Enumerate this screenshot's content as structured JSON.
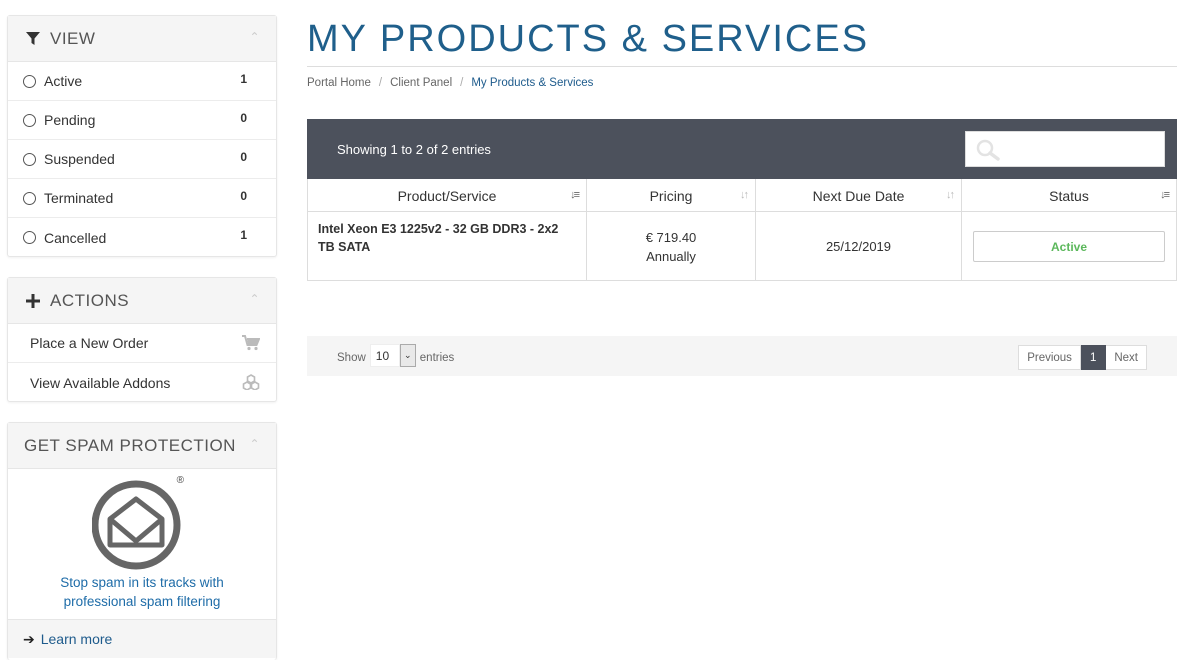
{
  "sidebar": {
    "view": {
      "title": "VIEW",
      "items": [
        {
          "label": "Active",
          "count": "1"
        },
        {
          "label": "Pending",
          "count": "0"
        },
        {
          "label": "Suspended",
          "count": "0"
        },
        {
          "label": "Terminated",
          "count": "0"
        },
        {
          "label": "Cancelled",
          "count": "1"
        }
      ]
    },
    "actions": {
      "title": "ACTIONS",
      "items": [
        {
          "label": "Place a New Order",
          "icon": "cart-icon"
        },
        {
          "label": "View Available Addons",
          "icon": "cubes-icon"
        }
      ]
    },
    "spam": {
      "title": "GET SPAM PROTECTION",
      "trademark": "®",
      "text_line1": "Stop spam in its tracks with",
      "text_line2": "professional spam filtering",
      "learn_more": "Learn more"
    }
  },
  "page": {
    "title": "MY PRODUCTS & SERVICES",
    "breadcrumb": [
      "Portal Home",
      "Client Panel",
      "My Products & Services"
    ]
  },
  "table": {
    "info": "Showing 1 to 2 of 2 entries",
    "search_placeholder": "",
    "columns": [
      "Product/Service",
      "Pricing",
      "Next Due Date",
      "Status"
    ],
    "rows": [
      {
        "product": "Intel Xeon E3 1225v2 - 32 GB DDR3 - 2x2 TB SATA",
        "price": "€ 719.40",
        "cycle": "Annually",
        "due": "25/12/2019",
        "status": "Active"
      }
    ],
    "length_label_before": "Show",
    "length_value": "10",
    "length_label_after": "entries",
    "pager": {
      "previous": "Previous",
      "current": "1",
      "next": "Next"
    }
  },
  "colors": {
    "brand": "#1f5f8b",
    "table_bar": "#4c515c",
    "status_active": "#5cb85c"
  }
}
